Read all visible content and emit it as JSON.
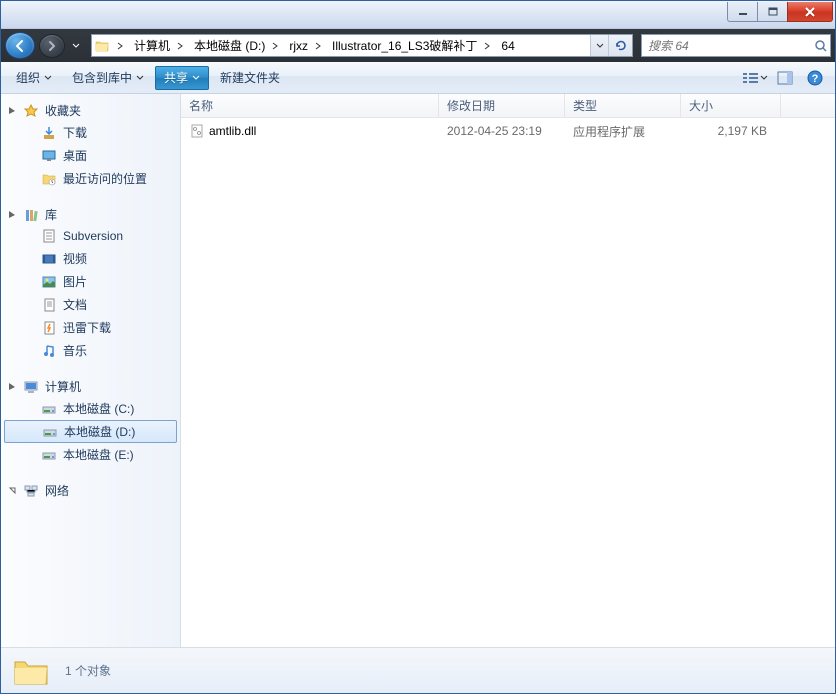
{
  "breadcrumb": {
    "items": [
      {
        "label": "计算机"
      },
      {
        "label": "本地磁盘 (D:)"
      },
      {
        "label": "rjxz"
      },
      {
        "label": "Illustrator_16_LS3破解补丁"
      },
      {
        "label": "64"
      }
    ]
  },
  "search": {
    "placeholder": "搜索 64"
  },
  "toolbar": {
    "organize": "组织",
    "include": "包含到库中",
    "share": "共享",
    "new_folder": "新建文件夹"
  },
  "sidebar": {
    "favorites": {
      "label": "收藏夹",
      "items": [
        {
          "label": "下载"
        },
        {
          "label": "桌面"
        },
        {
          "label": "最近访问的位置"
        }
      ]
    },
    "libraries": {
      "label": "库",
      "items": [
        {
          "label": "Subversion"
        },
        {
          "label": "视频"
        },
        {
          "label": "图片"
        },
        {
          "label": "文档"
        },
        {
          "label": "迅雷下载"
        },
        {
          "label": "音乐"
        }
      ]
    },
    "computer": {
      "label": "计算机",
      "items": [
        {
          "label": "本地磁盘 (C:)"
        },
        {
          "label": "本地磁盘 (D:)"
        },
        {
          "label": "本地磁盘 (E:)"
        }
      ]
    },
    "network": {
      "label": "网络"
    }
  },
  "columns": {
    "name": "名称",
    "date": "修改日期",
    "type": "类型",
    "size": "大小"
  },
  "files": [
    {
      "name": "amtlib.dll",
      "date": "2012-04-25 23:19",
      "type": "应用程序扩展",
      "size": "2,197 KB"
    }
  ],
  "status": {
    "count": "1 个对象"
  }
}
